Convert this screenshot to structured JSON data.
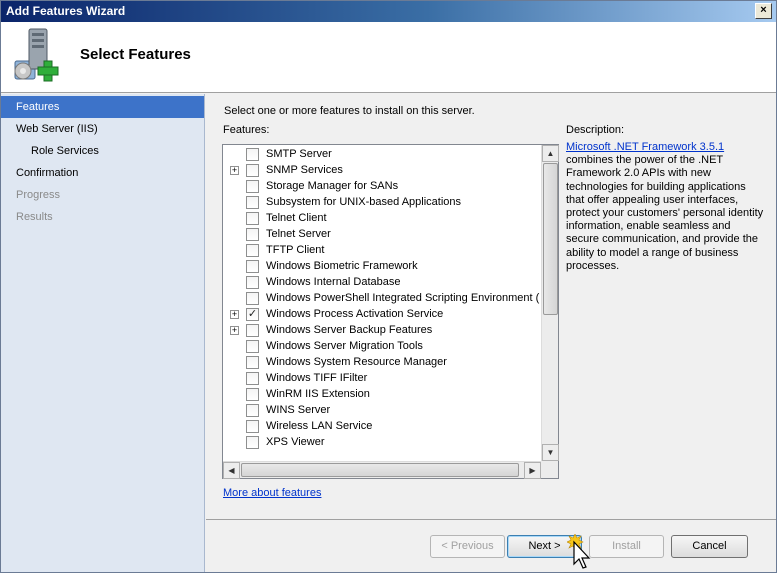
{
  "window": {
    "title": "Add Features Wizard",
    "close_symbol": "×"
  },
  "header": {
    "title": "Select Features",
    "icon": "server-add-features-icon"
  },
  "sidebar": {
    "items": [
      {
        "label": "Features",
        "state": "active"
      },
      {
        "label": "Web Server (IIS)",
        "state": "normal"
      },
      {
        "label": "Role Services",
        "state": "sub"
      },
      {
        "label": "Confirmation",
        "state": "normal"
      },
      {
        "label": "Progress",
        "state": "disabled"
      },
      {
        "label": "Results",
        "state": "disabled"
      }
    ]
  },
  "main": {
    "instruction": "Select one or more features to install on this server.",
    "features_label": "Features:",
    "description_label": "Description:",
    "description_link": "Microsoft .NET Framework 3.5.1",
    "description_text": "combines the power of the .NET Framework 2.0 APIs with new technologies for building applications that offer appealing user interfaces, protect your customers' personal identity information, enable seamless and secure communication, and provide the ability to model a range of business processes.",
    "features": [
      {
        "label": "SMTP Server",
        "expandable": false,
        "checked": false
      },
      {
        "label": "SNMP Services",
        "expandable": true,
        "checked": false
      },
      {
        "label": "Storage Manager for SANs",
        "expandable": false,
        "checked": false
      },
      {
        "label": "Subsystem for UNIX-based Applications",
        "expandable": false,
        "checked": false
      },
      {
        "label": "Telnet Client",
        "expandable": false,
        "checked": false
      },
      {
        "label": "Telnet Server",
        "expandable": false,
        "checked": false
      },
      {
        "label": "TFTP Client",
        "expandable": false,
        "checked": false
      },
      {
        "label": "Windows Biometric Framework",
        "expandable": false,
        "checked": false
      },
      {
        "label": "Windows Internal Database",
        "expandable": false,
        "checked": false
      },
      {
        "label": "Windows PowerShell Integrated Scripting Environment (IS",
        "expandable": false,
        "checked": false
      },
      {
        "label": "Windows Process Activation Service",
        "expandable": true,
        "checked": true
      },
      {
        "label": "Windows Server Backup Features",
        "expandable": true,
        "checked": false
      },
      {
        "label": "Windows Server Migration Tools",
        "expandable": false,
        "checked": false
      },
      {
        "label": "Windows System Resource Manager",
        "expandable": false,
        "checked": false
      },
      {
        "label": "Windows TIFF IFilter",
        "expandable": false,
        "checked": false
      },
      {
        "label": "WinRM IIS Extension",
        "expandable": false,
        "checked": false
      },
      {
        "label": "WINS Server",
        "expandable": false,
        "checked": false
      },
      {
        "label": "Wireless LAN Service",
        "expandable": false,
        "checked": false
      },
      {
        "label": "XPS Viewer",
        "expandable": false,
        "checked": false
      }
    ],
    "more_link": "More about features"
  },
  "footer": {
    "previous": "< Previous",
    "next": "Next >",
    "install": "Install",
    "cancel": "Cancel"
  },
  "scrollbar_symbols": {
    "up": "▲",
    "down": "▼",
    "left": "◀",
    "right": "▶"
  }
}
